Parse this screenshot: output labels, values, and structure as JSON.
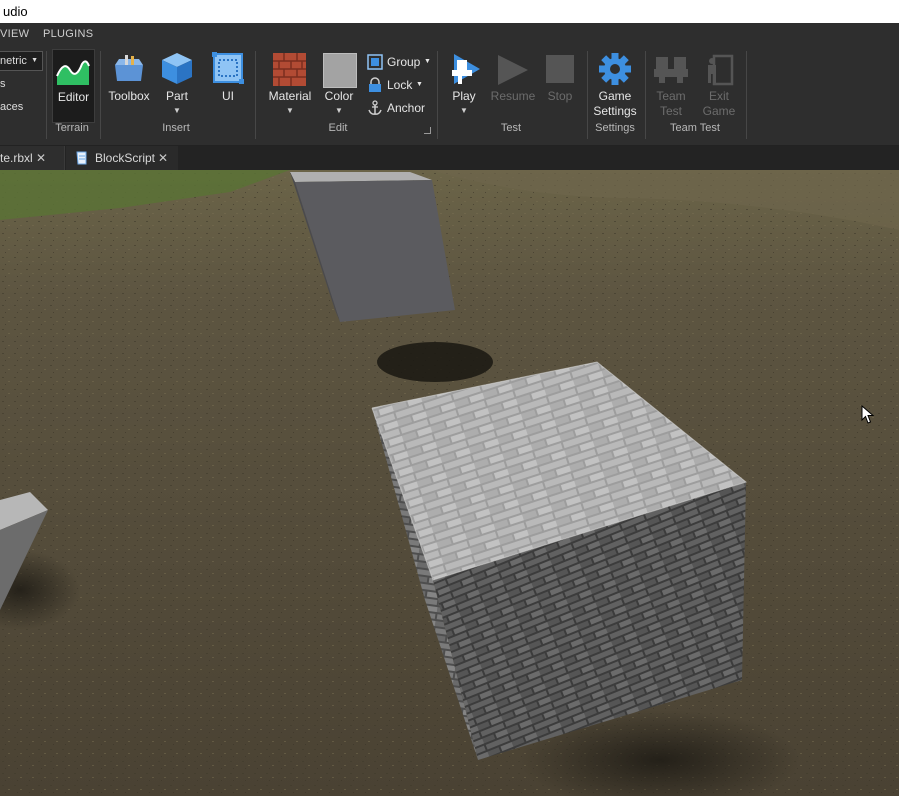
{
  "window": {
    "title": "udio"
  },
  "menu": {
    "items": [
      "VIEW",
      "PLUGINS"
    ]
  },
  "ribbon": {
    "dropdown_value": "netric",
    "left_partial_items": [
      "s",
      "aces"
    ],
    "terrain": {
      "editor_label": "Editor",
      "group_label": "Terrain"
    },
    "insert": {
      "toolbox_label": "Toolbox",
      "part_label": "Part",
      "ui_label": "UI",
      "group_label": "Insert"
    },
    "edit": {
      "material_label": "Material",
      "color_label": "Color",
      "group_label_small": "Group",
      "lock_label": "Lock",
      "anchor_label": "Anchor",
      "group_label": "Edit"
    },
    "test": {
      "play_label": "Play",
      "resume_label": "Resume",
      "stop_label": "Stop",
      "group_label": "Test"
    },
    "settings": {
      "game_settings_line1": "Game",
      "game_settings_line2": "Settings",
      "group_label": "Settings"
    },
    "team_test": {
      "team_test_line1": "Team",
      "team_test_line2": "Test",
      "exit_game_line1": "Exit",
      "exit_game_line2": "Game",
      "group_label": "Team Test"
    }
  },
  "tabs": [
    {
      "label": "te.rbxl",
      "close": "✕"
    },
    {
      "label": "BlockScript",
      "close": "✕"
    }
  ],
  "colors": {
    "accent_blue": "#3d8fe0",
    "terrain_green": "#2fbf63",
    "brick_red": "#b24b34",
    "ribbon_bg": "#2e2e2e"
  }
}
